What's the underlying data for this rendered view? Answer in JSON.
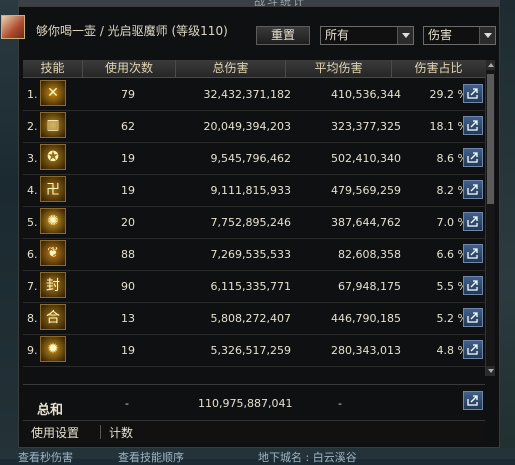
{
  "window": {
    "title": "战斗统计"
  },
  "header": {
    "player_name": "够你喝一壶 / 光启驱魔师 (等级110)",
    "reset_label": "重置",
    "scope_selected": "所有",
    "metric_selected": "伤害"
  },
  "table": {
    "columns": [
      "技能",
      "使用次数",
      "总伤害",
      "平均伤害",
      "伤害占比"
    ],
    "rows": [
      {
        "rank": "1.",
        "icon": "sword-cross-icon",
        "color": "#c98a14",
        "casts": "79",
        "total": "32,432,371,182",
        "avg": "410,536,344",
        "pct": "29.2 %"
      },
      {
        "rank": "2.",
        "icon": "scroll-talisman-icon",
        "color": "#b8861c",
        "casts": "62",
        "total": "20,049,394,203",
        "avg": "323,377,325",
        "pct": "18.1 %"
      },
      {
        "rank": "3.",
        "icon": "pentagram-icon",
        "color": "#a87a18",
        "casts": "19",
        "total": "9,545,796,462",
        "avg": "502,410,340",
        "pct": "8.6 %"
      },
      {
        "rank": "4.",
        "icon": "rune-glyph-icon",
        "color": "#9c6f12",
        "casts": "19",
        "total": "9,111,815,933",
        "avg": "479,569,259",
        "pct": "8.2 %"
      },
      {
        "rank": "5.",
        "icon": "light-burst-icon",
        "color": "#d09a1e",
        "casts": "20",
        "total": "7,752,895,246",
        "avg": "387,644,762",
        "pct": "7.0 %"
      },
      {
        "rank": "6.",
        "icon": "flame-wing-icon",
        "color": "#c27a16",
        "casts": "88",
        "total": "7,269,535,533",
        "avg": "82,608,358",
        "pct": "6.6 %"
      },
      {
        "rank": "7.",
        "icon": "seal-character-icon",
        "color": "#a57a1a",
        "casts": "90",
        "total": "6,115,335,771",
        "avg": "67,948,175",
        "pct": "5.5 %"
      },
      {
        "rank": "8.",
        "icon": "unity-character-icon",
        "color": "#9a7216",
        "casts": "13",
        "total": "5,808,272,407",
        "avg": "446,790,185",
        "pct": "5.2 %"
      },
      {
        "rank": "9.",
        "icon": "radiant-strike-icon",
        "color": "#c4901c",
        "casts": "19",
        "total": "5,326,517,259",
        "avg": "280,343,013",
        "pct": "4.8 %"
      }
    ]
  },
  "summary": {
    "label": "总和",
    "casts": "-",
    "total": "110,975,887,041",
    "avg": "-"
  },
  "footer": {
    "settings_label": "使用设置",
    "count_label": "计数"
  },
  "underlay": {
    "left_text": "查看秒伤害",
    "mid_text": "查看技能顺序",
    "right_text": "地下城名 : 白云溪谷"
  }
}
